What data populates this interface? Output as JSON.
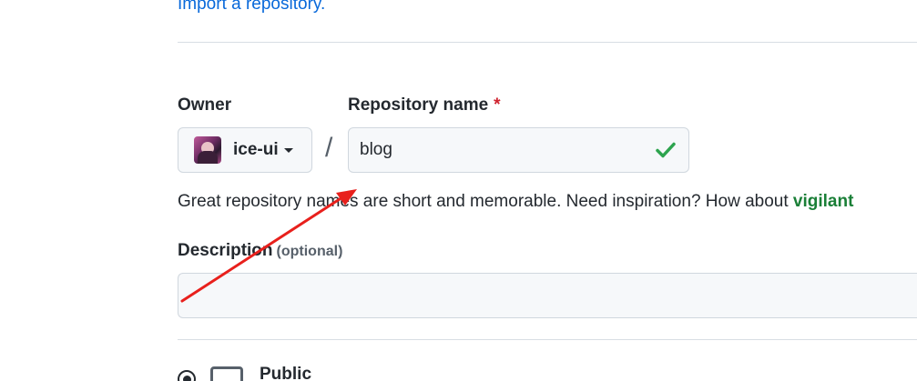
{
  "import_link": "Import a repository.",
  "owner": {
    "label": "Owner",
    "name": "ice-ui"
  },
  "separator": "/",
  "repository": {
    "label": "Repository name",
    "required_marker": "*",
    "value": "blog"
  },
  "hint": {
    "text": "Great repository names are short and memorable. Need inspiration? How about ",
    "suggestion": "vigilant"
  },
  "description": {
    "label": "Description",
    "optional": "(optional)",
    "value": ""
  },
  "visibility": {
    "public_label": "Public"
  },
  "colors": {
    "link": "#0969da",
    "required": "#cf222e",
    "valid_check": "#2da44e",
    "suggestion": "#1a7f37",
    "annotation_arrow": "#e8201c"
  }
}
